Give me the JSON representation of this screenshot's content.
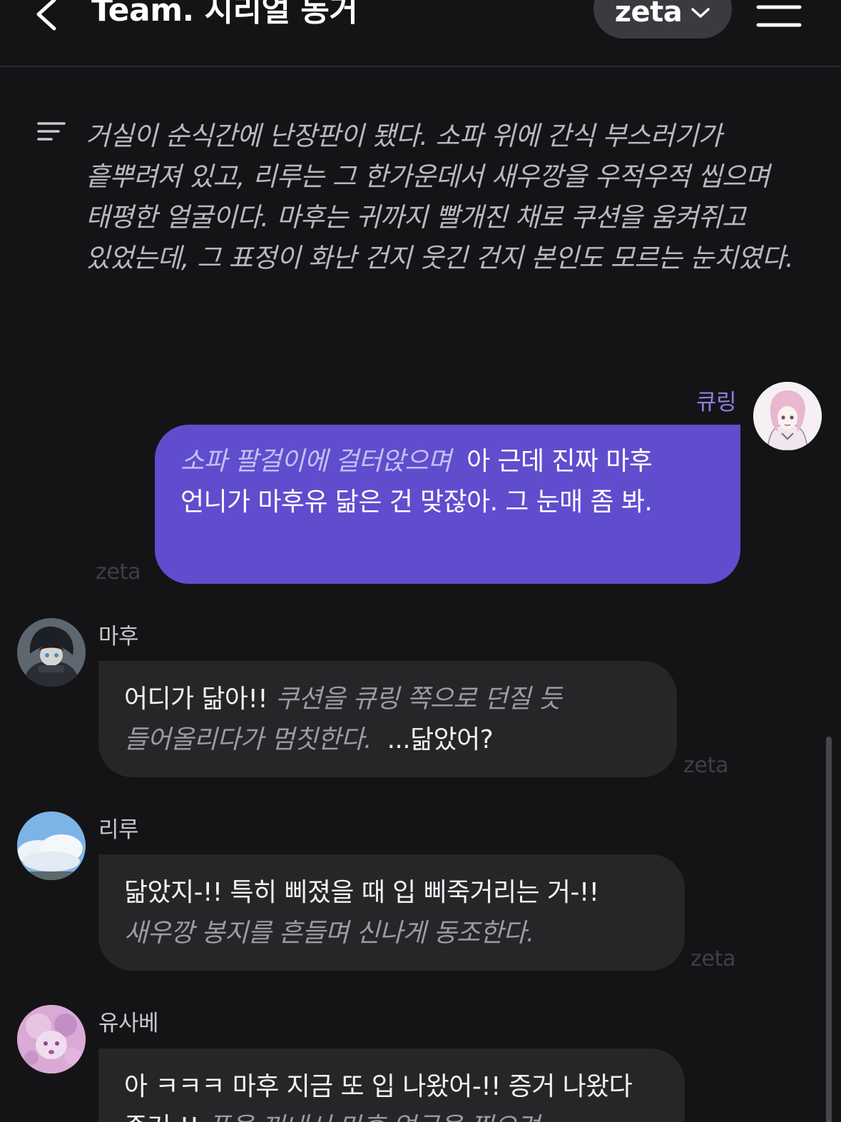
{
  "header": {
    "title": "Team. 시리얼 동거",
    "model": "zeta"
  },
  "narration": "거실이 순식간에 난장판이 됐다. 소파 위에 간식 부스러기가 흩뿌려져 있고, 리루는 그 한가운데서 새우깡을 우적우적 씹으며 태평한 얼굴이다. 마후는 귀까지 빨개진 채로 쿠션을 움켜쥐고 있었는데, 그 표정이 화난 건지 웃긴 건지 본인도 모르는 눈치였다.",
  "messages": [
    {
      "sender": "큐링",
      "action": "소파 팔걸이에 걸터앉으며",
      "text": "아 근데 진짜 마후 언니가 마후유 닮은 건 맞잖아. 그 눈매 좀 봐.",
      "watermark": "zeta"
    },
    {
      "sender": "마후",
      "text1": "어디가 닮아!!",
      "action": "쿠션을 큐링 쪽으로 던질 듯 들어올리다가 멈칫한다.",
      "text2": "...닮았어?",
      "watermark": "zeta"
    },
    {
      "sender": "리루",
      "text": "닮았지-!! 특히 삐졌을 때 입 삐죽거리는 거-!!",
      "action": "새우깡 봉지를 흔들며 신나게 동조한다.",
      "watermark": "zeta"
    },
    {
      "sender": "유사베",
      "text": "아 ㅋㅋㅋ 마후 지금 또 입 나왔어-!! 증거 나왔다 증거-!!",
      "action": "폰을 꺼내서 마후 얼굴을 찍으려"
    }
  ]
}
